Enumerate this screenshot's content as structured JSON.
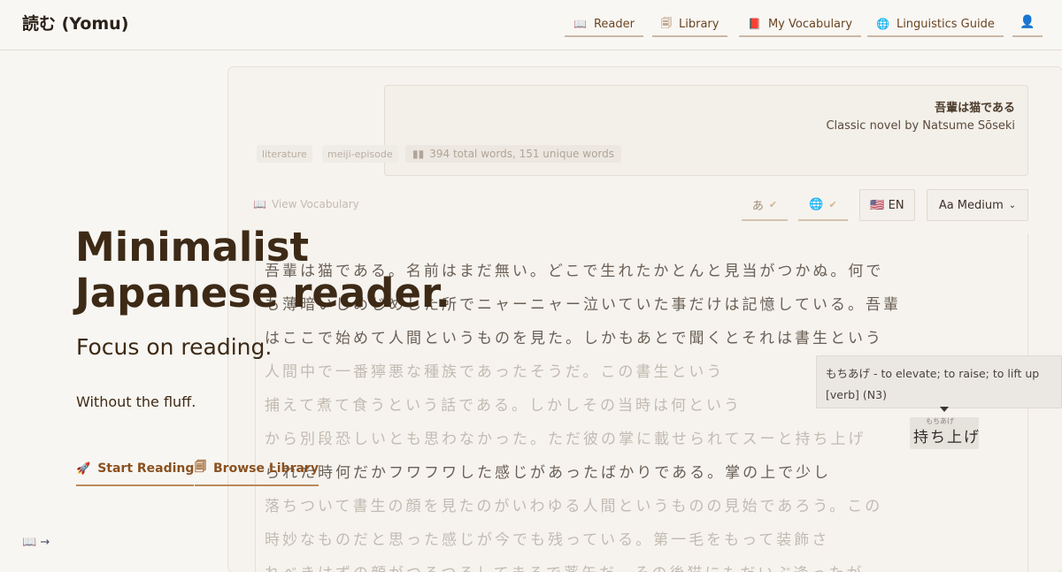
{
  "header": {
    "logo": "読む (Yomu)",
    "nav": [
      {
        "label": "Reader",
        "icon": "📖"
      },
      {
        "label": "Library",
        "icon": "🗐"
      },
      {
        "label": "My Vocabulary",
        "icon": "📕"
      },
      {
        "label": "Linguistics Guide",
        "icon": "🌐"
      }
    ],
    "user_icon": "👤"
  },
  "hero": {
    "title": "Minimalist Japanese reader.",
    "subtitle": "Focus on reading.",
    "tagline": "Without the fluff.",
    "start_label": "Start Reading",
    "start_icon": "🚀",
    "library_label": "Browse Library",
    "library_icon": "🗐",
    "corner_link": "📖 →"
  },
  "preview": {
    "book_title": "吾輩は猫である",
    "book_subtitle": "Classic novel by Natsume Sōseki",
    "tags": [
      "literature",
      "meiji-episode"
    ],
    "stats": "394 total words, 151 unique words",
    "view_vocab": "View Vocabulary",
    "controls": {
      "furigana": "あ",
      "translate": "🌐",
      "language": "🇺🇸 EN",
      "font_size": "Aa Medium"
    },
    "lines": [
      "吾輩は猫である。名前はまだ無い。どこで生れたかとんと見当がつかぬ。何で",
      "も薄暗いじめじめした所でニャーニャー泣いていた事だけは記憶している。吾輩",
      "はここで始めて人間というものを見た。しかもあとで聞くとそれは書生という",
      "人間中で一番獰悪な種族であったそうだ。この書生という",
      "捕えて煮て食うという話である。しかしその当時は何という",
      "から別段恐しいとも思わなかった。ただ彼の掌に載せられてスーと持ち上げ",
      "られた時何だかフワフワした感じがあったばかりである。掌の上で少し",
      "落ちついて書生の顔を見たのがいわゆる人間というものの見始であろう。この",
      "時妙なものだと思った感じが今でも残っている。第一毛をもって装飾さ",
      "れべきはずの顔がつるつるしてまるで薬缶だ。その後猫にもだいぶ逢ったが"
    ],
    "highlight_word": "持ち上げ",
    "highlight_reading": "もちあげ",
    "tooltip": {
      "definition": "もちあげ - to elevate; to raise; to lift up",
      "info": "[verb] (N3)"
    }
  }
}
